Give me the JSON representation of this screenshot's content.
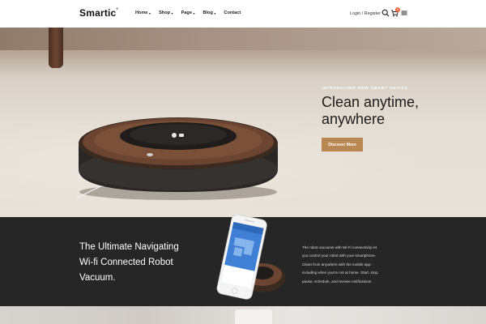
{
  "header": {
    "logo": "Smartic",
    "logo_mark": "°",
    "nav": [
      {
        "label": "Home",
        "has_dropdown": true
      },
      {
        "label": "Shop",
        "has_dropdown": true
      },
      {
        "label": "Page",
        "has_dropdown": true
      },
      {
        "label": "Blog",
        "has_dropdown": true
      },
      {
        "label": "Contact",
        "has_dropdown": false
      }
    ],
    "caret": "▾",
    "login_label": "Login / Register",
    "icons": [
      "search-icon",
      "cart-icon",
      "menu-icon"
    ],
    "cart_count": "0"
  },
  "hero": {
    "eyebrow": "INTRODUCING NEW SMART DEVICE",
    "title_line1": "Clean anytime,",
    "title_line2": "anywhere",
    "cta_label": "Discover More",
    "accent_color": "#b88752"
  },
  "feature": {
    "title_line1": "The Ultimate Navigating",
    "title_line2": "Wi-fi Connected Robot",
    "title_line3": "Vacuum.",
    "body_lines": [
      "The robot vacuums with Wi-Fi connectivity let",
      "you control your robot with your smartphone.",
      "Clean from anywhere with the mobile app -",
      "including when you're not at home. Start, stop,",
      "pause, schedule, and receive notifications"
    ],
    "background_color": "#262626"
  }
}
